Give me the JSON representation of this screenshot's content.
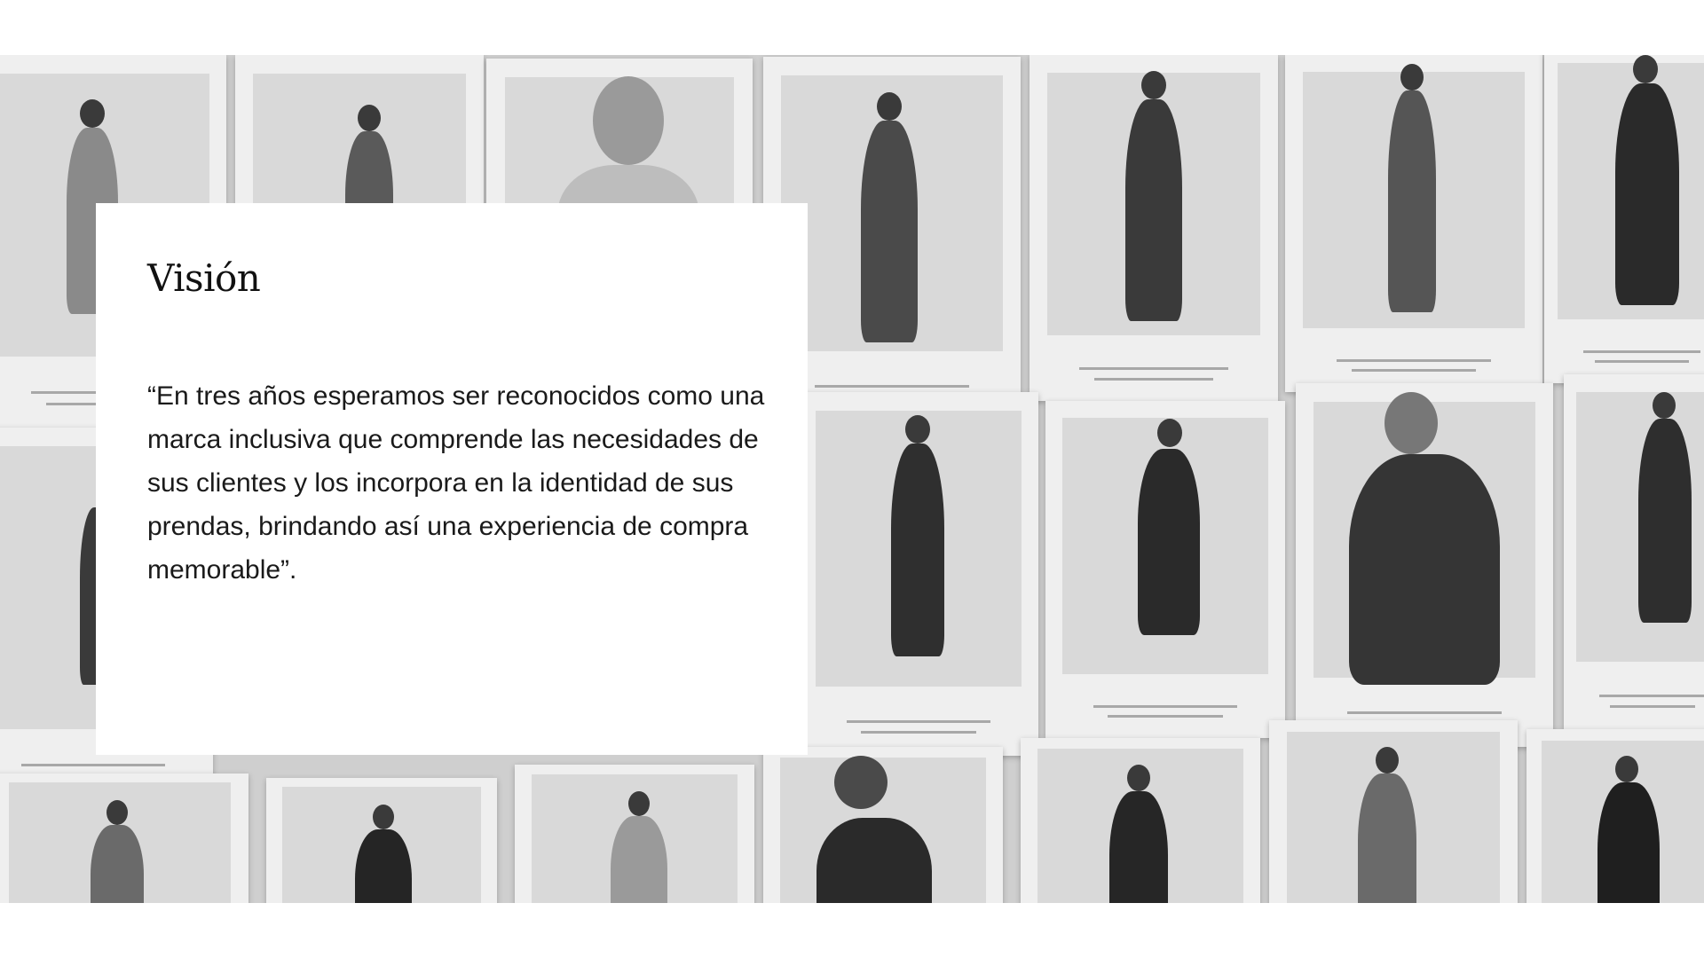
{
  "vision": {
    "title": "Visión",
    "quote": "“En tres años esperamos ser reconocidos como una marca inclusiva que comprende las necesidades de sus clientes y los incorpora en la identidad de sus prendas, brindando así una experiencia de compra memorable”."
  },
  "background": {
    "image": "moodboard-fashion-photos-grayscale",
    "colors": {
      "band": "#cfcfcf",
      "print": "#efefef",
      "figure": "#2e2e2e"
    }
  }
}
